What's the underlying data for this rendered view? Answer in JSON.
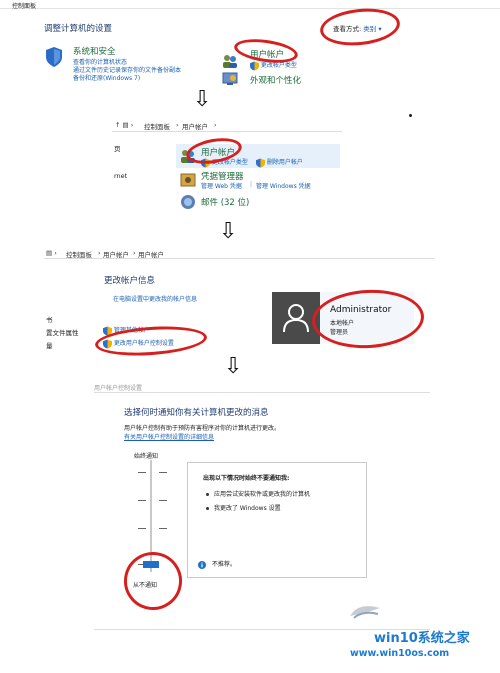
{
  "panel1": {
    "topbar_title": "控制面板",
    "heading": "调整计算机的设置",
    "view_by_label": "查看方式:",
    "view_by_value": "类别",
    "system": {
      "title": "系统和安全",
      "links": [
        "查看你的计算机状态",
        "通过文件历史记录保存你的文件备份副本",
        "备份和还原(Windows 7)"
      ]
    },
    "user_accounts": {
      "title": "用户帐户",
      "link": "更改帐户类型"
    },
    "appearance": {
      "title": "外观和个性化"
    }
  },
  "panel2": {
    "breadcrumb": [
      "控制面板",
      "用户帐户"
    ],
    "left_items": [
      "页",
      "rnet"
    ],
    "user_accounts": {
      "title": "用户帐户",
      "links": [
        "更改帐户类型",
        "删除用户帐户"
      ]
    },
    "credential": {
      "title": "凭据管理器",
      "links": [
        "管理 Web 凭据",
        "管理 Windows 凭据"
      ]
    },
    "mail": {
      "title": "邮件 (32 位)"
    }
  },
  "panel3": {
    "breadcrumb": [
      "控制面板",
      "用户帐户",
      "用户帐户"
    ],
    "heading": "更改帐户信息",
    "link": "在电脑设置中更改我的帐户信息",
    "left_items": [
      "书",
      "置文件属性",
      "量"
    ],
    "links": [
      "管理其他帐户",
      "更改用户帐户控制设置"
    ],
    "account_name": "Administrator",
    "account_type": "本地帐户",
    "account_role": "管理员"
  },
  "panel4": {
    "window_title": "用户帐户控制设置",
    "heading": "选择何时通知你有关计算机更改的消息",
    "desc": "用户帐户控制有助于预防有害程序对你的计算机进行更改。",
    "link": "有关用户帐户控制设置的详细信息",
    "top_label": "始终通知",
    "bottom_label": "从不通知",
    "level": 0,
    "box_title": "出现以下情况时始终不要通知我:",
    "bullets": [
      "应用尝试安装软件或更改我的计算机",
      "我更改了 Windows 设置"
    ],
    "note": "不推荐。"
  },
  "watermark": {
    "title": "win10系统之家",
    "url": "www.win10os.com"
  },
  "colors": {
    "annotation_red": "#d61f1f",
    "link_blue": "#1a5fb4",
    "slider_thumb": "#1e70c8"
  }
}
